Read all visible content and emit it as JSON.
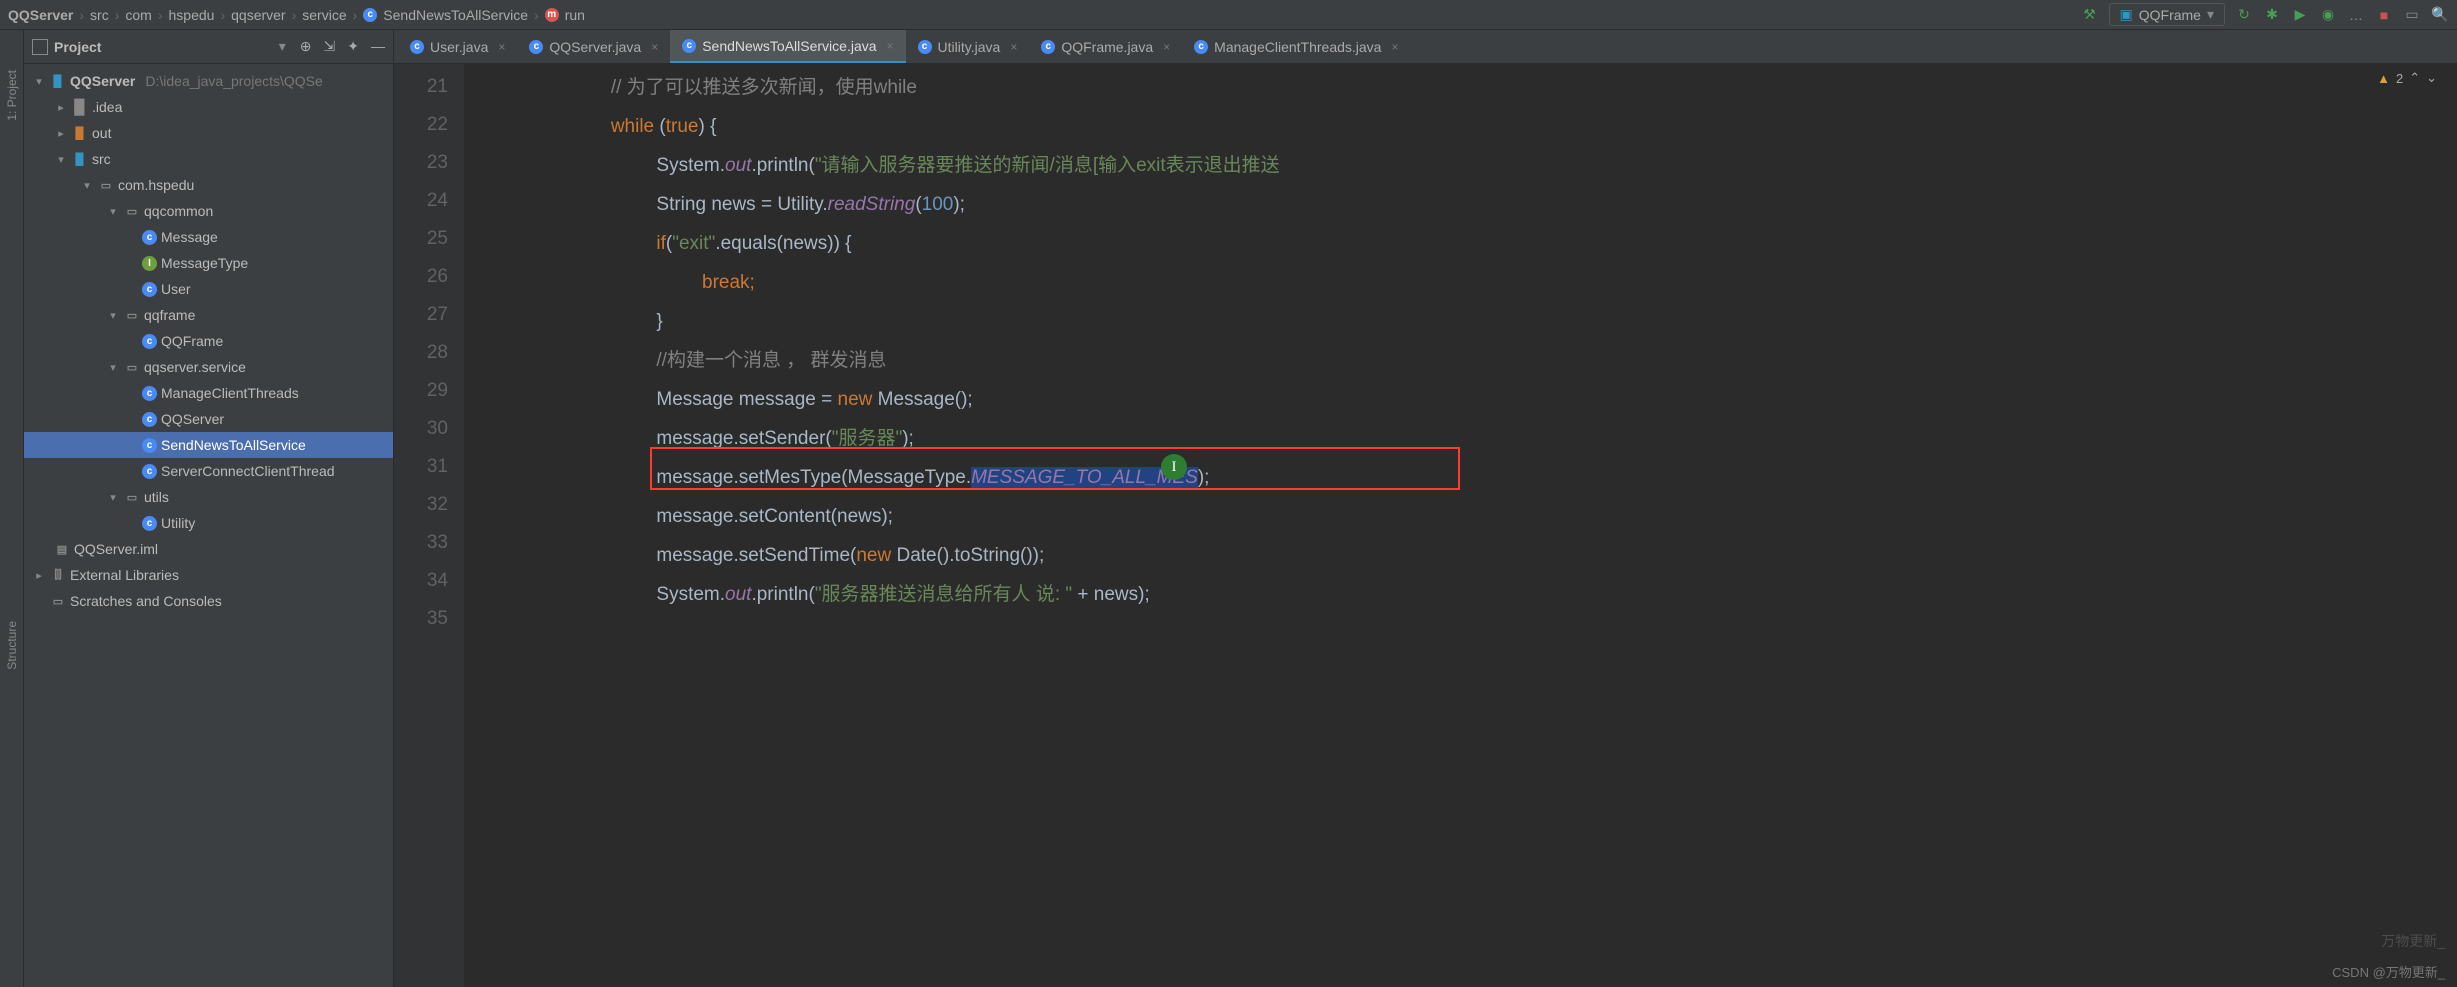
{
  "breadcrumbs": [
    {
      "label": "QQServer"
    },
    {
      "label": "src"
    },
    {
      "label": "com"
    },
    {
      "label": "hspedu"
    },
    {
      "label": "qqserver"
    },
    {
      "label": "service"
    },
    {
      "label": "SendNewsToAllService",
      "icon": "c"
    },
    {
      "label": "run",
      "icon": "m"
    }
  ],
  "run_config": "QQFrame",
  "warning_count": "2",
  "left_stripe": {
    "project": "1: Project",
    "structure": "Structure"
  },
  "panel": {
    "title": "Project",
    "root_name": "QQServer",
    "root_hint": "D:\\idea_java_projects\\QQSe",
    "idea": ".idea",
    "out": "out",
    "src": "src",
    "pkg_com": "com.hspedu",
    "pkg_qqcommon": "qqcommon",
    "cls_message": "Message",
    "cls_messagetype": "MessageType",
    "cls_user": "User",
    "pkg_qqframe": "qqframe",
    "cls_qqframe": "QQFrame",
    "pkg_qqserver": "qqserver.service",
    "cls_mct": "ManageClientThreads",
    "cls_qqserver": "QQServer",
    "cls_sendnews": "SendNewsToAllService",
    "cls_scct": "ServerConnectClientThread",
    "pkg_utils": "utils",
    "cls_utility": "Utility",
    "iml": "QQServer.iml",
    "ext_lib": "External Libraries",
    "scratches": "Scratches and Consoles"
  },
  "tabs": [
    {
      "label": "User.java"
    },
    {
      "label": "QQServer.java"
    },
    {
      "label": "SendNewsToAllService.java",
      "active": true
    },
    {
      "label": "Utility.java"
    },
    {
      "label": "QQFrame.java"
    },
    {
      "label": "ManageClientThreads.java"
    }
  ],
  "gutter_lines": [
    "21",
    "22",
    "23",
    "24",
    "25",
    "26",
    "27",
    "28",
    "29",
    "30",
    "31",
    "32",
    "33",
    "34",
    "35"
  ],
  "code_lines": {
    "l21_cmt": "// 为了可以推送多次新闻，使用while",
    "l22_a": "while",
    "l22_b": " (",
    "l22_c": "true",
    "l22_d": ") {",
    "l23_a": "System.",
    "l23_b": "out",
    "l23_c": ".println(",
    "l23_d": "\"请输入服务器要推送的新闻/消息[输入exit表示退出推送",
    "l24_a": "String news = Utility.",
    "l24_b": "readString",
    "l24_c": "(",
    "l24_d": "100",
    "l24_e": ");",
    "l25_a": "if",
    "l25_b": "(",
    "l25_c": "\"exit\"",
    "l25_d": ".equals(news)) {",
    "l26_a": "break;",
    "l27_a": "}",
    "l28_a": "//构建一个消息 ， 群发消息",
    "l29_a": "Message message = ",
    "l29_b": "new",
    "l29_c": " Message();",
    "l30_a": "message.setSender(",
    "l30_b": "\"服务器\"",
    "l30_c": ");",
    "l31_a": "message.setMesType(MessageType.",
    "l31_b": "MESSAGE_TO_ALL_MES",
    "l31_c": ");",
    "l32_a": "message.setContent(news);",
    "l33_a": "message.setSendTime(",
    "l33_b": "new",
    "l33_c": " Date().toString());",
    "l34_a": "System.",
    "l34_b": "out",
    "l34_c": ".println(",
    "l34_d": "\"服务器推送消息给所有人 说: \"",
    "l34_e": " + news);"
  },
  "watermark": "CSDN @万物更新_",
  "watermark2": "万物更新_"
}
